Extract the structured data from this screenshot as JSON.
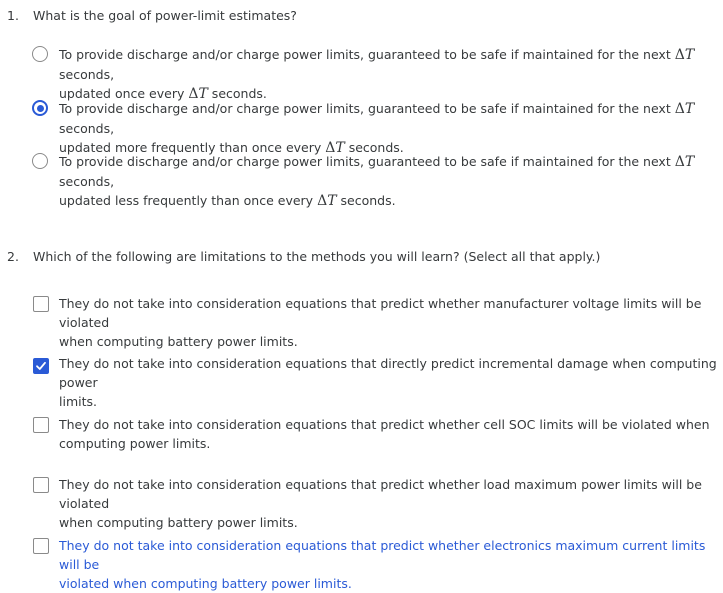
{
  "q1": {
    "number": "1.",
    "text": "What is the goal of power-limit estimates?",
    "options": [
      {
        "part1": "To provide discharge and/or charge power limits, guaranteed to be safe if maintained for the next ",
        "sym1_delta": "Δ",
        "sym1_t": "T",
        "part2": " seconds,",
        "part3": "updated once every ",
        "sym2_delta": "Δ",
        "sym2_t": "T",
        "part4": " seconds.",
        "selected": false
      },
      {
        "part1": "To provide discharge and/or charge power limits, guaranteed to be safe if maintained for the next ",
        "sym1_delta": "Δ",
        "sym1_t": "T",
        "part2": " seconds,",
        "part3": "updated more frequently than once every ",
        "sym2_delta": "Δ",
        "sym2_t": "T",
        "part4": " seconds.",
        "selected": true
      },
      {
        "part1": "To provide discharge and/or charge power limits, guaranteed to be safe if maintained for the next ",
        "sym1_delta": "Δ",
        "sym1_t": "T",
        "part2": " seconds,",
        "part3": "updated less frequently than once every ",
        "sym2_delta": "Δ",
        "sym2_t": "T",
        "part4": " seconds.",
        "selected": false
      }
    ]
  },
  "q2": {
    "number": "2.",
    "text": "Which of the following are limitations to the methods you will learn? (Select all that apply.)",
    "options": [
      {
        "line1": "They do not take into consideration equations that predict whether manufacturer voltage limits will be violated",
        "line2": "when computing battery power limits.",
        "checked": false
      },
      {
        "line1": "They do not take into consideration equations that directly predict incremental damage when computing power",
        "line2": "limits.",
        "checked": true
      },
      {
        "line1": "They do not take into consideration equations that predict whether cell SOC limits will be violated when",
        "line2": "computing power limits.",
        "checked": false
      },
      {
        "line1": "They do not take into consideration equations that predict whether load maximum power limits will be violated",
        "line2": "when computing battery power limits.",
        "checked": false
      },
      {
        "line1": "They do not take into consideration equations that predict whether electronics maximum current limits will be",
        "line2": "violated when computing battery power limits.",
        "checked": false
      }
    ]
  },
  "colors": {
    "accent": "#2a5ad6",
    "text": "#373a3c",
    "border": "#8a8a8a"
  }
}
